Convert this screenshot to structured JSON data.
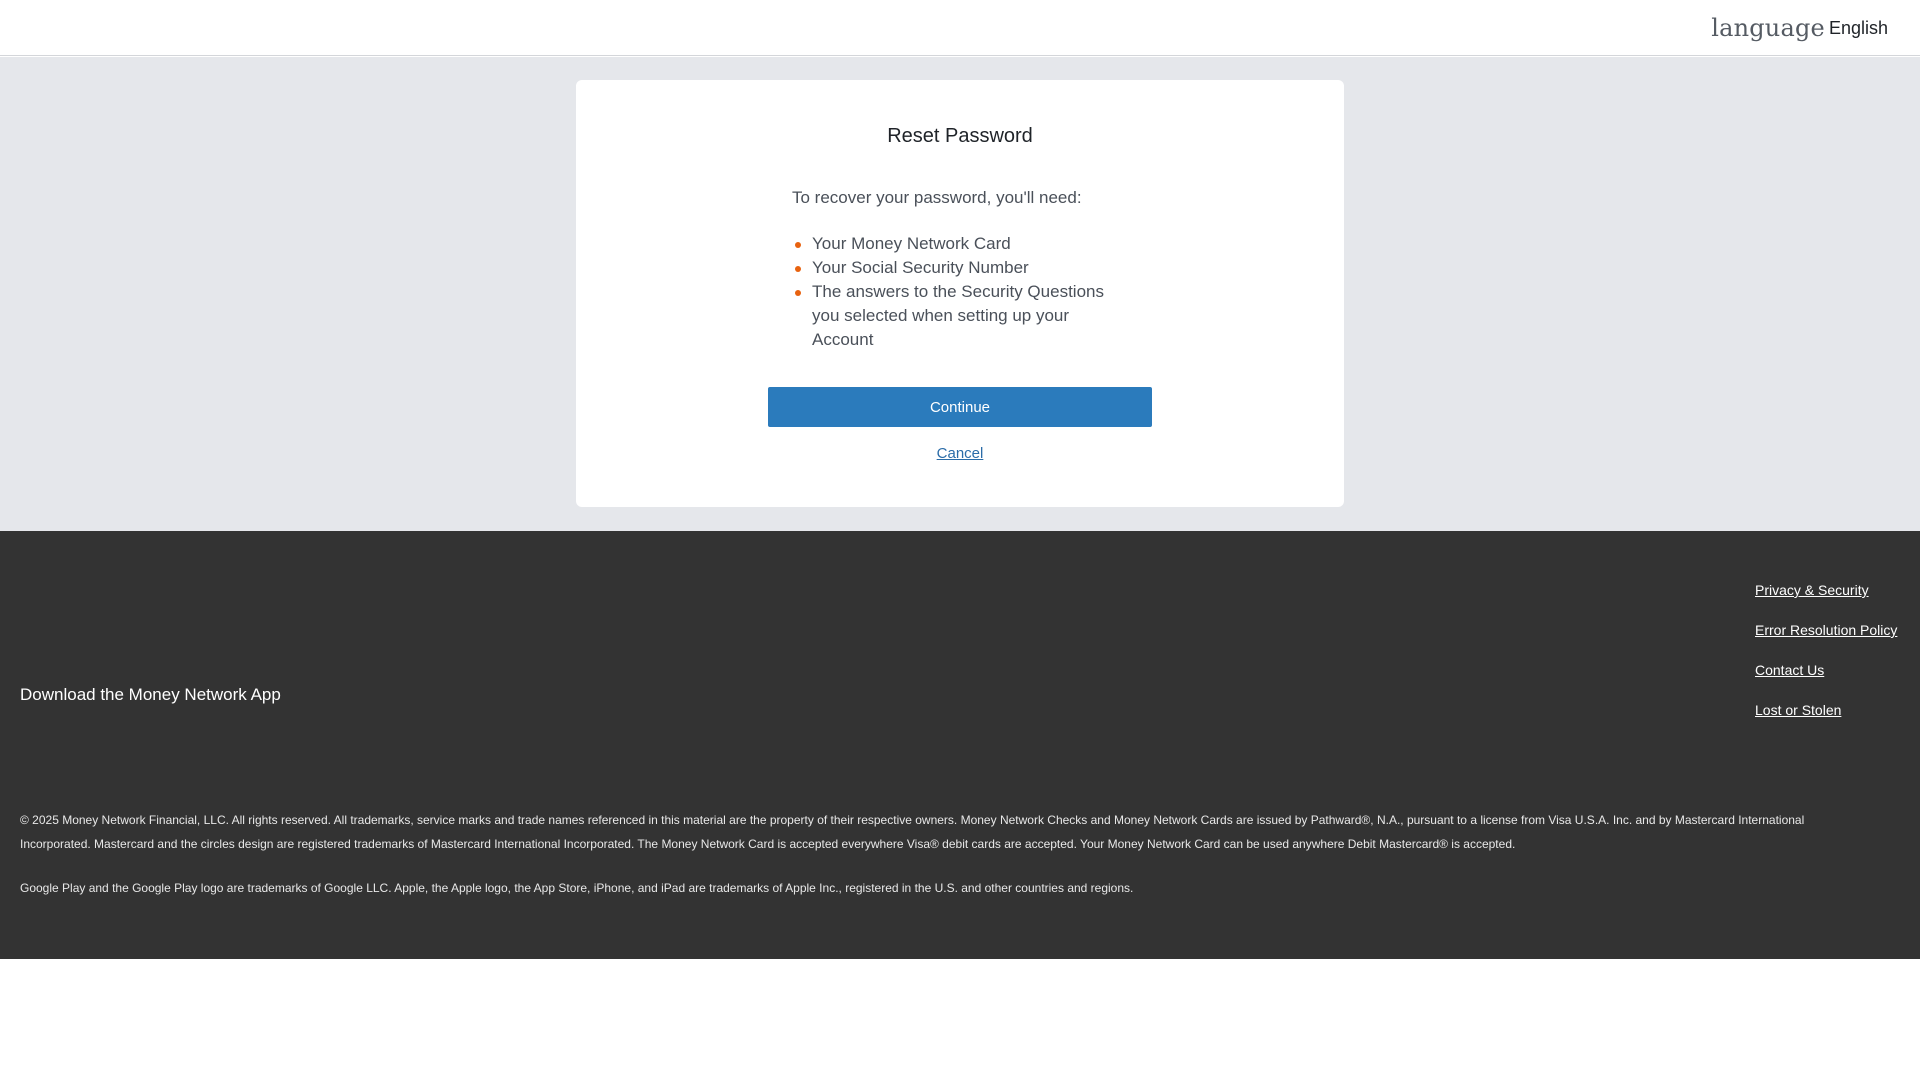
{
  "header": {
    "language_icon_text": "language",
    "language_label": "English"
  },
  "card": {
    "title": "Reset Password",
    "intro": "To recover your password, you'll need:",
    "requirements": [
      "Your Money Network Card",
      "Your Social Security Number",
      "The answers to the Security Questions you selected when setting up your Account"
    ],
    "continue_label": "Continue",
    "cancel_label": "Cancel"
  },
  "footer": {
    "download_text": "Download the Money Network App",
    "links": [
      "Privacy & Security",
      "Error Resolution Policy",
      "Contact Us",
      "Lost or Stolen"
    ],
    "legal_1": "© 2025 Money Network Financial, LLC. All rights reserved. All trademarks, service marks and trade names referenced in this material are the property of their respective owners. Money Network Checks and Money Network Cards are issued by Pathward®, N.A., pursuant to a license from Visa U.S.A. Inc. and by Mastercard International Incorporated. Mastercard and the circles design are registered trademarks of Mastercard International Incorporated. The Money Network Card is accepted everywhere Visa® debit cards are accepted. Your Money Network Card can be used anywhere Debit Mastercard® is accepted.",
    "legal_2": "Google Play and the Google Play logo are trademarks of Google LLC. Apple, the Apple logo, the App Store, iPhone, and iPad are trademarks of Apple Inc., registered in the U.S. and other countries and regions."
  },
  "colors": {
    "primary_button": "#2b7bbc",
    "bullet": "#e8620f",
    "footer_bg": "#333333",
    "page_bg": "#e5e7eb"
  }
}
